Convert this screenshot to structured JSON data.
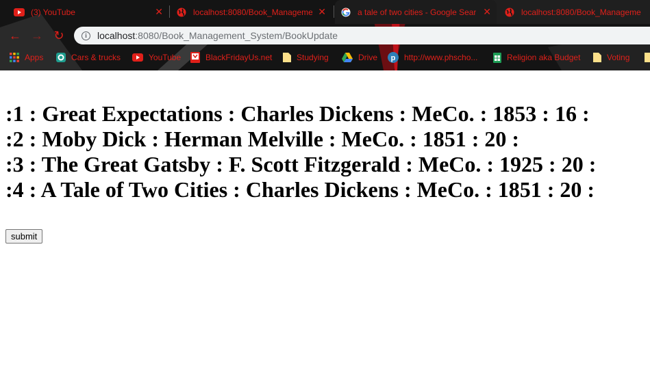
{
  "tabs": [
    {
      "title": "(3) YouTube",
      "icon": "youtube-icon"
    },
    {
      "title": "localhost:8080/Book_Manageme",
      "icon": "globe-icon"
    },
    {
      "title": "a tale of two cities - Google Sear",
      "icon": "google-icon"
    },
    {
      "title": "localhost:8080/Book_Manageme",
      "icon": "globe-icon"
    }
  ],
  "address_bar": {
    "host": "localhost",
    "path": ":8080/Book_Management_System/BookUpdate"
  },
  "bookmarks": [
    {
      "label": "Apps",
      "icon": "apps-grid-icon"
    },
    {
      "label": "Cars & trucks",
      "icon": "cars-site-icon"
    },
    {
      "label": "YouTube",
      "icon": "youtube-icon"
    },
    {
      "label": "BlackFridayUs.net",
      "icon": "blackfriday-site-icon"
    },
    {
      "label": "Studying",
      "icon": "folder-icon"
    },
    {
      "label": "Drive",
      "icon": "google-drive-icon"
    },
    {
      "label": "http://www.phscho...",
      "icon": "p-site-icon"
    },
    {
      "label": "Religion aka Budget",
      "icon": "spreadsheet-icon"
    },
    {
      "label": "Voting",
      "icon": "folder-icon"
    }
  ],
  "records": [
    ":1 : Great Expectations : Charles Dickens : MeCo. : 1853 : 16 :",
    ":2 : Moby Dick : Herman Melville : MeCo. : 1851 : 20 :",
    ":3 : The Great Gatsby : F. Scott Fitzgerald : MeCo. : 1925 : 20 :",
    ":4 : A Tale of Two Cities : Charles Dickens : MeCo. : 1851 : 20 :"
  ],
  "form": {
    "submit_label": "submit"
  },
  "colors": {
    "chrome_accent": "#e0201a",
    "chrome_bg": "#141414",
    "omnibox_bg": "#f1f3f4"
  }
}
